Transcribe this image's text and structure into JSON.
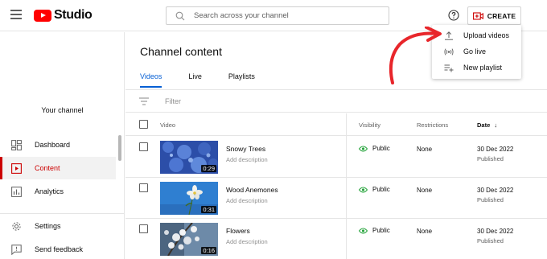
{
  "header": {
    "logo_text": "Studio",
    "search_placeholder": "Search across your channel",
    "create_label": "CREATE"
  },
  "create_menu": [
    {
      "label": "Upload videos",
      "icon": "upload-icon"
    },
    {
      "label": "Go live",
      "icon": "live-icon"
    },
    {
      "label": "New playlist",
      "icon": "playlist-add-icon"
    }
  ],
  "sidebar": {
    "channel_label": "Your channel",
    "items": [
      {
        "label": "Dashboard",
        "icon": "dashboard-icon",
        "active": false
      },
      {
        "label": "Content",
        "icon": "content-icon",
        "active": true
      },
      {
        "label": "Analytics",
        "icon": "analytics-icon",
        "active": false
      },
      {
        "label": "Settings",
        "icon": "gear-icon",
        "active": false
      },
      {
        "label": "Send feedback",
        "icon": "feedback-icon",
        "active": false
      }
    ]
  },
  "main": {
    "title": "Channel content",
    "tabs": [
      {
        "label": "Videos",
        "active": true
      },
      {
        "label": "Live",
        "active": false
      },
      {
        "label": "Playlists",
        "active": false
      }
    ],
    "filter_placeholder": "Filter",
    "columns": {
      "video": "Video",
      "visibility": "Visibility",
      "restrictions": "Restrictions",
      "date": "Date"
    },
    "videos": [
      {
        "title": "Snowy Trees",
        "description": "Add description",
        "duration": "0:29",
        "visibility": "Public",
        "restrictions": "None",
        "date": "30 Dec 2022",
        "status": "Published"
      },
      {
        "title": "Wood Anemones",
        "description": "Add description",
        "duration": "0:31",
        "visibility": "Public",
        "restrictions": "None",
        "date": "30 Dec 2022",
        "status": "Published"
      },
      {
        "title": "Flowers",
        "description": "Add description",
        "duration": "0:16",
        "visibility": "Public",
        "restrictions": "None",
        "date": "30 Dec 2022",
        "status": "Published"
      }
    ]
  },
  "colors": {
    "brand_red": "#ff0000",
    "active_red": "#cc0000",
    "tab_blue": "#065fd4",
    "visibility_green": "#2ba640",
    "annotation_arrow": "#e8262b"
  }
}
